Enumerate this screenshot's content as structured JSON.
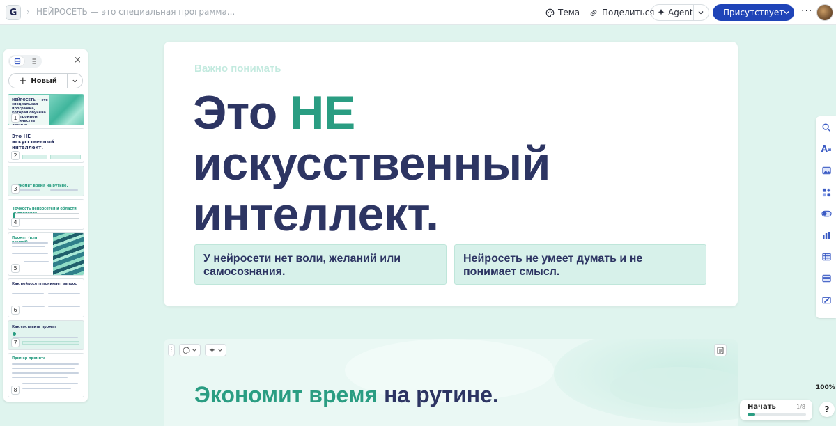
{
  "topbar": {
    "logo_letter": "G",
    "doc_title": "НЕЙРОСЕТЬ — это специальная программа...",
    "theme_label": "Тема",
    "share_label": "Поделиться",
    "agent_label": "Agent",
    "present_label": "Присутствует"
  },
  "panel": {
    "new_label": "Новый",
    "slides": [
      {
        "number": "1",
        "title": "НЕЙРОСЕТЬ — это специальная программа, которая обучена на огромном количестве данных"
      },
      {
        "number": "2",
        "title": "Это НЕ искусственный интеллект."
      },
      {
        "number": "3",
        "title": "Экономит время на рутине."
      },
      {
        "number": "4",
        "title": "Точность нейросетей и области применения"
      },
      {
        "number": "5",
        "title": "Промпт (или prompt)"
      },
      {
        "number": "6",
        "title": "Как нейросеть понимает запрос"
      },
      {
        "number": "7",
        "title": "Как составить промпт"
      },
      {
        "number": "8",
        "title": "Пример промпта"
      }
    ]
  },
  "slide1": {
    "kicker": "Важно понимать",
    "headline_pre": "Это ",
    "headline_accent": "НЕ",
    "headline_line2": "искусственный",
    "headline_line3": "интеллект.",
    "callout1": "У нейросети нет воли, желаний или самосознания.",
    "callout2": "Нейросеть не умеет думать и не понимает смысл."
  },
  "slide2": {
    "title_accent": "Экономит время",
    "title_rest": " на рутине."
  },
  "status": {
    "zoom": "100%",
    "start_label": "Начать",
    "progress_text": "1/8",
    "progress_fraction": 0.125,
    "help_label": "?"
  },
  "colors": {
    "accent_green": "#2a9d82",
    "navy": "#2d3563",
    "present_blue": "#1f44b8",
    "background": "#dff4ee"
  }
}
